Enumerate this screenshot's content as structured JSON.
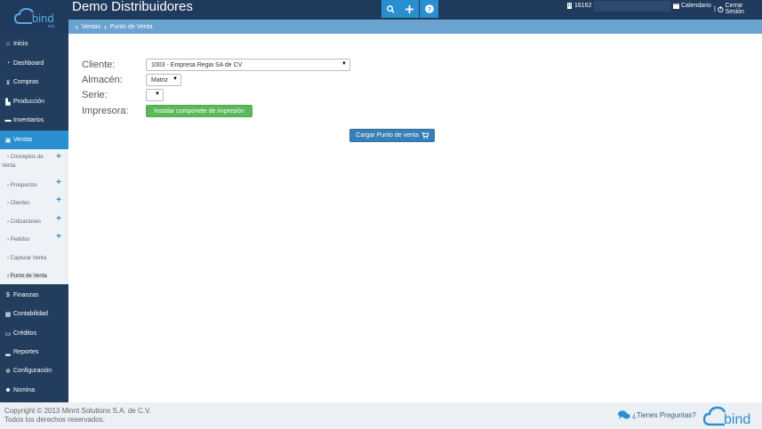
{
  "app": {
    "title": "Demo Distribuidores",
    "logo_text": "bind",
    "logo_sub": "erp"
  },
  "topbar": {
    "user_id": "16162",
    "calendar_label": "Calendario",
    "separator": "|",
    "logout_label": "Cerrar Sesión",
    "search_icon": "search-icon",
    "add_icon": "plus-icon",
    "help_icon": "question-icon"
  },
  "breadcrumb": {
    "items": [
      "Ventas",
      "Punto de Venta"
    ]
  },
  "sidebar": {
    "items": [
      {
        "label": "Inicio",
        "icon": "home-icon"
      },
      {
        "label": "Dashboard",
        "icon": "dashboard-icon"
      },
      {
        "label": "Compras",
        "icon": "cart-icon"
      },
      {
        "label": "Producción",
        "icon": "factory-icon"
      },
      {
        "label": "Inventarios",
        "icon": "truck-icon"
      },
      {
        "label": "Ventas",
        "icon": "tag-icon"
      },
      {
        "label": "Finanzas",
        "icon": "dollar-icon"
      },
      {
        "label": "Contabilidad",
        "icon": "calculator-icon"
      },
      {
        "label": "Créditos",
        "icon": "credit-card-icon"
      },
      {
        "label": "Reportes",
        "icon": "bar-chart-icon"
      },
      {
        "label": "Configuración",
        "icon": "gears-icon"
      },
      {
        "label": "Nomina",
        "icon": "users-icon"
      }
    ],
    "sub_items": [
      {
        "label": "Conceptos de",
        "label2": "Venta",
        "plus": "+"
      },
      {
        "label": "Prospectos",
        "plus": "+"
      },
      {
        "label": "Clientes",
        "plus": "+"
      },
      {
        "label": "Cotizaciones",
        "plus": "+"
      },
      {
        "label": "Pedidos",
        "plus": "+"
      },
      {
        "label": "Capturar Venta"
      },
      {
        "label": "Punto de Venta"
      }
    ]
  },
  "form": {
    "cliente_label": "Cliente:",
    "cliente_value": "1003 - Empresa Regia SA de CV",
    "almacen_label": "Almacén:",
    "almacen_value": "Matriz",
    "serie_label": "Serie:",
    "serie_value": "",
    "impresora_label": "Impresora:",
    "install_button": "Instalar componete de impresión",
    "load_button": "Cargar Punto de venta"
  },
  "footer": {
    "copyright_line1": "Copyright © 2013 Minnt Solutions S.A. de C.V.",
    "copyright_line2": "Todos los derechos reservados.",
    "help_text": "¿Tienes Preguntas?",
    "logo_text": "bind"
  },
  "colors": {
    "header_bg": "#1f3a5c",
    "accent": "#2a8fd0",
    "breadcrumb_bg": "#6aa3cf",
    "green_button": "#5cb85c",
    "blue_button": "#3a7fb5"
  }
}
